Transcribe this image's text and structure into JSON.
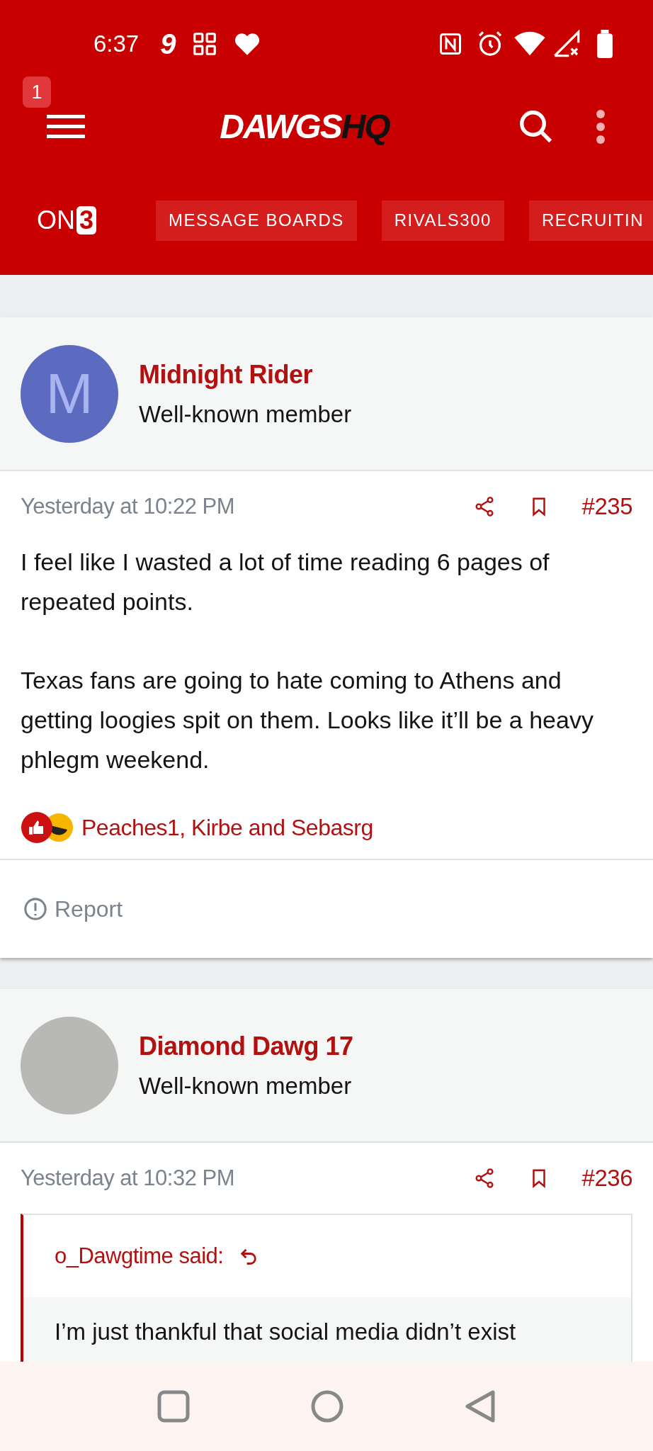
{
  "status_bar": {
    "time": "6:37",
    "carrier_glyph": "9"
  },
  "header": {
    "badge": "1",
    "logo_main": "DAWGS",
    "logo_accent": "HQ"
  },
  "nav": {
    "brand_main": "ON",
    "brand_accent": "3",
    "links": [
      "MESSAGE BOARDS",
      "RIVALS300",
      "RECRUITIN"
    ]
  },
  "posts": [
    {
      "author": "Midnight Rider",
      "role": "Well-known member",
      "avatar": {
        "kind": "letter",
        "letter": "M"
      },
      "time": "Yesterday at 10:22 PM",
      "number": "#235",
      "paragraphs": [
        "I feel like I wasted a lot of time reading 6 pages of repeated points.",
        "Texas fans are going to hate coming to Athens and getting loogies spit on them. Looks like it’ll be a heavy phlegm weekend."
      ],
      "reactions": "Peaches1, Kirbe and Sebasrg",
      "report": "Report"
    },
    {
      "author": "Diamond Dawg 17",
      "role": "Well-known member",
      "avatar": {
        "kind": "photo"
      },
      "time": "Yesterday at 10:32 PM",
      "number": "#236",
      "quote": {
        "author": "o_Dawgtime said:",
        "text": "I’m just thankful that social media didn’t exist"
      }
    }
  ]
}
